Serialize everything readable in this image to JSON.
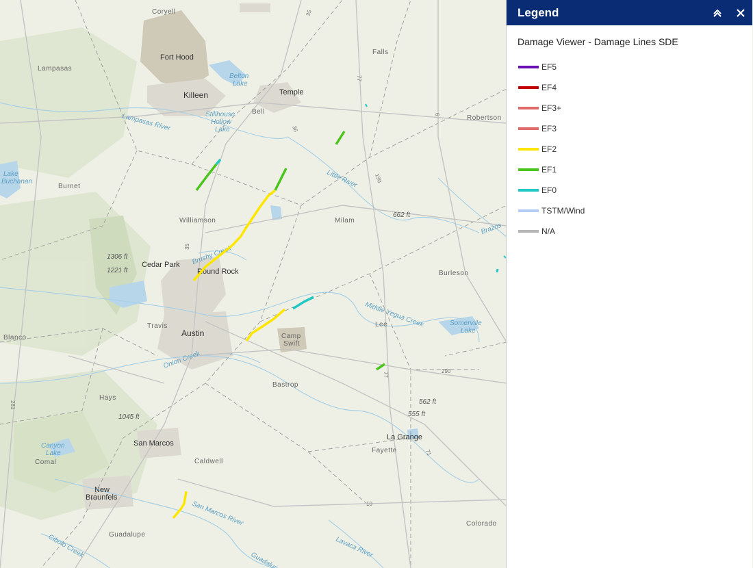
{
  "map": {
    "labels": {
      "coryell": "Coryell",
      "fort_hood": "Fort Hood",
      "lampasas": "Lampasas",
      "belton_lake": "Belton\nLake",
      "killeen": "Killeen",
      "temple": "Temple",
      "bell": "Bell",
      "falls": "Falls",
      "robertson": "Robertson",
      "stillhouse": "Stillhouse\nHollow\nLake",
      "lampasas_river": "Lampasas River",
      "lake_buchanan": "Lake\nBuchanan",
      "burnet": "Burnet",
      "little_river": "Little River",
      "williamson": "Williamson",
      "milam": "Milam",
      "elev_662": "662 ft",
      "brazos": "Brazos",
      "elev_1306": "1306 ft",
      "cedar_park": "Cedar Park",
      "elev_1221": "1221 ft",
      "brushy_creek": "Brushy Creek",
      "round_rock": "Round Rock",
      "burleson": "Burleson",
      "middle_yegua": "Middle Yegua Creek",
      "travis": "Travis",
      "lee": "Lee",
      "somerville": "Somerville\nLake",
      "austin": "Austin",
      "camp_swift": "Camp\nSwift",
      "blanco": "Blanco",
      "onion_creek": "Onion Creek",
      "bastrop": "Bastrop",
      "hays": "Hays",
      "elev_1045": "1045 ft",
      "elev_562": "562 ft",
      "elev_555": "555 ft",
      "la_grange": "La Grange",
      "canyon_lake": "Canyon\nLake",
      "san_marcos": "San Marcos",
      "fayette": "Fayette",
      "comal": "Comal",
      "caldwell": "Caldwell",
      "new_braunfels": "New\nBraunfels",
      "san_marcos_river": "San Marcos River",
      "guadalupe": "Guadalupe",
      "colorado": "Colorado",
      "cibolo": "Cibolo Creek",
      "lavaca": "Lavaca River",
      "guadalupe_river": "Guadalupe"
    },
    "highways": [
      "35",
      "77",
      "6",
      "190",
      "36",
      "290",
      "10",
      "71",
      "281",
      "35",
      "77"
    ],
    "damage_colors": {
      "EF2": "#ffe600",
      "EF1": "#4cc41e",
      "EF0": "#22c9c4"
    }
  },
  "legend": {
    "title": "Legend",
    "collapse_icon": "double-chevron-up-icon",
    "close_icon": "close-icon",
    "layer_title": "Damage Viewer - Damage Lines SDE",
    "items": [
      {
        "label": "EF5",
        "color": "#6a0fb4"
      },
      {
        "label": "EF4",
        "color": "#c40000"
      },
      {
        "label": "EF3+",
        "color": "#e06b6b"
      },
      {
        "label": "EF3",
        "color": "#e06b6b"
      },
      {
        "label": "EF2",
        "color": "#ffe600"
      },
      {
        "label": "EF1",
        "color": "#4cc41e"
      },
      {
        "label": "EF0",
        "color": "#22c9c4"
      },
      {
        "label": "TSTM/Wind",
        "color": "#b3cdf5"
      },
      {
        "label": "N/A",
        "color": "#b5b5b5"
      }
    ]
  }
}
